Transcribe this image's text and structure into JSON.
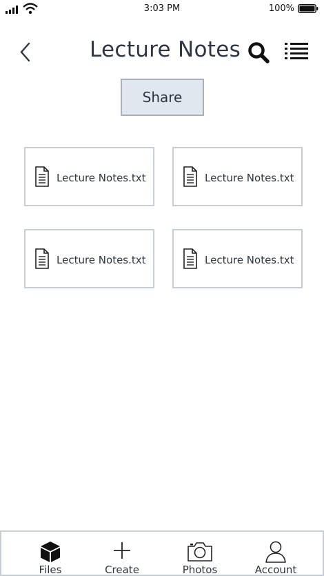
{
  "status_bar": {
    "time": "3:03 PM",
    "battery_percent": "100%"
  },
  "header": {
    "title": "Lecture Notes"
  },
  "actions": {
    "share_label": "Share"
  },
  "files": [
    {
      "name": "Lecture Notes.txt"
    },
    {
      "name": "Lecture Notes.txt"
    },
    {
      "name": "Lecture Notes.txt"
    },
    {
      "name": "Lecture Notes.txt"
    }
  ],
  "tab_bar": {
    "files_label": "Files",
    "create_label": "Create",
    "photos_label": "Photos",
    "account_label": "Account"
  }
}
